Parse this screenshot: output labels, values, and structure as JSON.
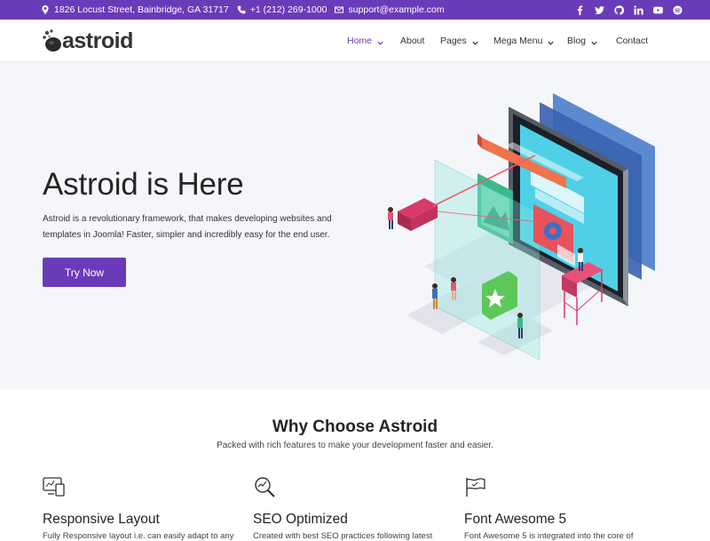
{
  "topbar": {
    "address": "1826 Locust Street, Bainbridge, GA 31717",
    "phone": "+1 (212) 269-1000",
    "email": "support@example.com",
    "socials": [
      "facebook-icon",
      "twitter-icon",
      "github-icon",
      "linkedin-icon",
      "youtube-icon",
      "spotify-icon"
    ],
    "bg_color": "#6a3bb8"
  },
  "header": {
    "logo_text": "astroid",
    "nav": [
      {
        "label": "Home",
        "active": true,
        "dropdown": true
      },
      {
        "label": "About",
        "active": false,
        "dropdown": false
      },
      {
        "label": "Pages",
        "active": false,
        "dropdown": true
      },
      {
        "label": "Mega Menu",
        "active": false,
        "dropdown": true
      },
      {
        "label": "Blog",
        "active": false,
        "dropdown": true
      },
      {
        "label": "Contact",
        "active": false,
        "dropdown": false
      }
    ]
  },
  "hero": {
    "title": "Astroid is Here",
    "description": "Astroid is a revolutionary framework, that makes developing websites and templates in Joomla! Faster, simpler and incredibly easy for the end user.",
    "button_label": "Try Now",
    "accent_color": "#6a3bb8"
  },
  "features": {
    "title": "Why Choose Astroid",
    "subtitle": "Packed with rich features to make your development faster and easier.",
    "items": [
      {
        "icon": "responsive-devices-icon",
        "title": "Responsive Layout",
        "text": "Fully Responsive layout i.e. can easily adapt to any"
      },
      {
        "icon": "seo-magnifier-icon",
        "title": "SEO Optimized",
        "text": "Created with best SEO practices following latest"
      },
      {
        "icon": "flag-icon",
        "title": "Font Awesome 5",
        "text": "Font Awesome 5 is integrated into the core of"
      }
    ]
  }
}
